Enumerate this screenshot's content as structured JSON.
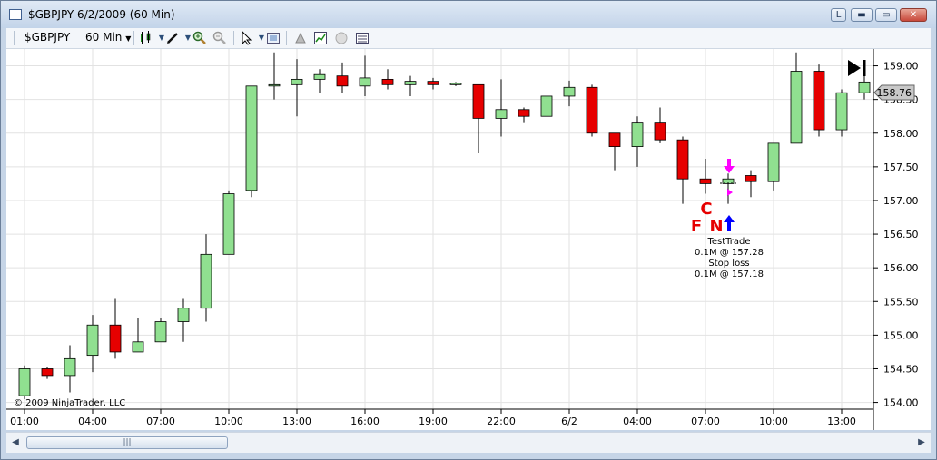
{
  "window": {
    "title": "$GBPJPY  6/2/2009 (60 Min)",
    "buttons": {
      "link": "L",
      "minimize": "▬",
      "maximize": "▭",
      "close": "✕"
    }
  },
  "toolbar": {
    "instrument": "$GBPJPY",
    "interval": "60 Min",
    "icons": [
      "candlestick-icon",
      "pencil-icon",
      "zoom-in-icon",
      "zoom-out-icon",
      "cursor-icon",
      "properties-icon",
      "strategy-icon",
      "chart-trader-icon",
      "circle-icon",
      "data-box-icon"
    ]
  },
  "chart": {
    "copyright": "© 2009 NinjaTrader, LLC",
    "current_price": "158.76",
    "y_ticks": [
      "159.00",
      "158.50",
      "158.00",
      "157.50",
      "157.00",
      "156.50",
      "156.00",
      "155.50",
      "155.00",
      "154.50",
      "154.00"
    ],
    "x_ticks": [
      "01:00",
      "04:00",
      "07:00",
      "10:00",
      "13:00",
      "16:00",
      "19:00",
      "22:00",
      "6/2",
      "04:00",
      "07:00",
      "10:00",
      "13:00"
    ],
    "markers": {
      "c_label": "C",
      "f_label": "F",
      "n_label": "N"
    },
    "annotation": [
      "TestTrade",
      "0.1M @ 157.28",
      "Stop loss",
      "0.1M @ 157.18"
    ],
    "colors": {
      "up": "#90e090",
      "down": "#e60000",
      "grid": "#e2e2e2",
      "entry_arrow": "#0000ff",
      "exit_arrow": "#ff00ff",
      "marker_text": "#e60000"
    }
  },
  "chart_data": {
    "type": "candlestick",
    "ylim": [
      153.9,
      159.25
    ],
    "candles": [
      {
        "o": 154.1,
        "h": 154.55,
        "l": 154.05,
        "c": 154.5
      },
      {
        "o": 154.5,
        "h": 154.52,
        "l": 154.35,
        "c": 154.4
      },
      {
        "o": 154.4,
        "h": 154.85,
        "l": 154.15,
        "c": 154.65
      },
      {
        "o": 154.7,
        "h": 155.3,
        "l": 154.45,
        "c": 155.15
      },
      {
        "o": 155.15,
        "h": 155.55,
        "l": 154.65,
        "c": 154.75
      },
      {
        "o": 154.75,
        "h": 155.25,
        "l": 154.75,
        "c": 154.9
      },
      {
        "o": 154.9,
        "h": 155.25,
        "l": 154.9,
        "c": 155.2
      },
      {
        "o": 155.2,
        "h": 155.55,
        "l": 154.9,
        "c": 155.4
      },
      {
        "o": 155.4,
        "h": 156.5,
        "l": 155.2,
        "c": 156.2
      },
      {
        "o": 156.2,
        "h": 157.15,
        "l": 156.2,
        "c": 157.1
      },
      {
        "o": 157.15,
        "h": 158.7,
        "l": 157.05,
        "c": 158.7
      },
      {
        "o": 158.7,
        "h": 159.2,
        "l": 158.5,
        "c": 158.72
      },
      {
        "o": 158.72,
        "h": 159.1,
        "l": 158.25,
        "c": 158.8
      },
      {
        "o": 158.8,
        "h": 158.95,
        "l": 158.6,
        "c": 158.87
      },
      {
        "o": 158.85,
        "h": 159.05,
        "l": 158.6,
        "c": 158.7
      },
      {
        "o": 158.7,
        "h": 159.15,
        "l": 158.55,
        "c": 158.82
      },
      {
        "o": 158.8,
        "h": 158.95,
        "l": 158.65,
        "c": 158.72
      },
      {
        "o": 158.72,
        "h": 158.85,
        "l": 158.55,
        "c": 158.77
      },
      {
        "o": 158.77,
        "h": 158.82,
        "l": 158.65,
        "c": 158.72
      },
      {
        "o": 158.74,
        "h": 158.76,
        "l": 158.7,
        "c": 158.74
      },
      {
        "o": 158.72,
        "h": 158.72,
        "l": 157.7,
        "c": 158.22
      },
      {
        "o": 158.22,
        "h": 158.8,
        "l": 157.95,
        "c": 158.35
      },
      {
        "o": 158.35,
        "h": 158.38,
        "l": 158.15,
        "c": 158.25
      },
      {
        "o": 158.25,
        "h": 158.55,
        "l": 158.25,
        "c": 158.55
      },
      {
        "o": 158.55,
        "h": 158.78,
        "l": 158.4,
        "c": 158.68
      },
      {
        "o": 158.68,
        "h": 158.72,
        "l": 157.95,
        "c": 158.0
      },
      {
        "o": 158.0,
        "h": 158.0,
        "l": 157.45,
        "c": 157.8
      },
      {
        "o": 157.8,
        "h": 158.25,
        "l": 157.5,
        "c": 158.15
      },
      {
        "o": 158.15,
        "h": 158.38,
        "l": 157.85,
        "c": 157.9
      },
      {
        "o": 157.9,
        "h": 157.95,
        "l": 156.95,
        "c": 157.32
      },
      {
        "o": 157.32,
        "h": 157.62,
        "l": 157.1,
        "c": 157.25
      },
      {
        "o": 157.25,
        "h": 157.4,
        "l": 156.95,
        "c": 157.32
      },
      {
        "o": 157.37,
        "h": 157.45,
        "l": 157.05,
        "c": 157.28
      },
      {
        "o": 157.28,
        "h": 157.85,
        "l": 157.15,
        "c": 157.85
      },
      {
        "o": 157.85,
        "h": 159.2,
        "l": 157.85,
        "c": 158.92
      },
      {
        "o": 158.92,
        "h": 159.02,
        "l": 157.95,
        "c": 158.05
      },
      {
        "o": 158.05,
        "h": 158.65,
        "l": 157.95,
        "c": 158.6
      },
      {
        "o": 158.6,
        "h": 158.92,
        "l": 158.5,
        "c": 158.76
      }
    ]
  }
}
